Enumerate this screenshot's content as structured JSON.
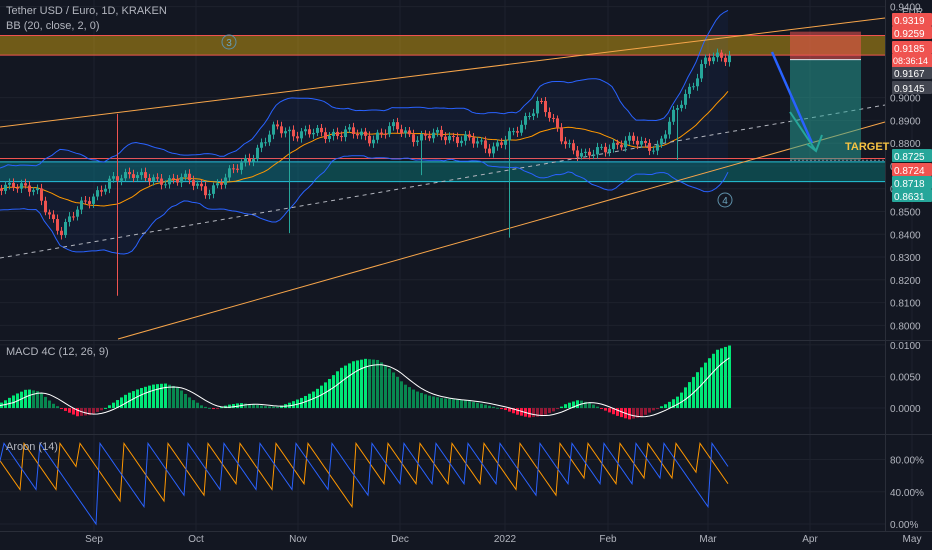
{
  "header": {
    "title": "Tether USD / Euro, 1D, KRAKEN",
    "indicator": "BB (20, close, 2, 0)",
    "currency": "EUR"
  },
  "macd_label": "MACD 4C (12, 26, 9)",
  "aroon_label": "Aroon (14)",
  "annotations": {
    "wave3": "3",
    "wave4": "4",
    "target": "TARGET",
    "countdown": "08:36:14"
  },
  "colors": {
    "background": "#131722",
    "bull": "#26a69a",
    "bear": "#ef5350",
    "bb_band": "#2962ff",
    "bb_basis": "#ff9800",
    "trendline": "#f7a54a",
    "zone_fill": "#f0b90b",
    "zone_support": "#0b6e6e",
    "macd_pos": "#00e676",
    "macd_neg": "#ff1744",
    "aroon_up": "#ff9800",
    "aroon_down": "#2962ff"
  },
  "chart_data": [
    {
      "type": "candlestick",
      "title": "Tether USD / Euro, 1D, KRAKEN",
      "ylim": [
        0.794,
        0.9407
      ],
      "x_ticks": [
        "Sep",
        "Oct",
        "Nov",
        "Dec",
        "2022",
        "Feb",
        "Mar",
        "Apr",
        "May"
      ],
      "y_ticks": [
        0.8,
        0.81,
        0.82,
        0.83,
        0.84,
        0.85,
        0.86,
        0.87,
        0.88,
        0.89,
        0.9,
        0.94
      ],
      "price_labels": [
        {
          "value": "0.9319",
          "color": "#ef5350"
        },
        {
          "value": "0.9259",
          "color": "#ef5350"
        },
        {
          "value": "0.9185",
          "color": "#ef5350"
        },
        {
          "value": "0.9167",
          "color": "#434651"
        },
        {
          "value": "0.9145",
          "color": "#434651"
        },
        {
          "value": "0.8725",
          "color": "#26a69a"
        },
        {
          "value": "0.8724",
          "color": "#ef5350"
        },
        {
          "value": "0.8718",
          "color": "#26a69a"
        },
        {
          "value": "0.8631",
          "color": "#26a69a"
        }
      ],
      "last_price": "0.9185",
      "zones": [
        {
          "name": "resistance",
          "from": 0.9187,
          "to": 0.9273
        },
        {
          "name": "support",
          "from": 0.8631,
          "to": 0.8718
        }
      ],
      "position": {
        "entry": 0.9167,
        "stop": 0.929,
        "target": 0.8725
      },
      "price_anchors": [
        0.8578,
        0.863,
        0.8576,
        0.841,
        0.8548,
        0.862,
        0.8679,
        0.8621,
        0.8658,
        0.8585,
        0.8656,
        0.8749,
        0.8865,
        0.8843,
        0.8842,
        0.8846,
        0.8826,
        0.8868,
        0.8822,
        0.8837,
        0.8814,
        0.8781,
        0.8838,
        0.8992,
        0.8818,
        0.8736,
        0.8794,
        0.8806,
        0.8784,
        0.8988,
        0.9162,
        0.9185
      ]
    },
    {
      "type": "bar",
      "title": "MACD 4C (12, 26, 9)",
      "ylim": [
        -0.003,
        0.0103
      ],
      "y_ticks": [
        "0.0100",
        "0.0050",
        "0.0000"
      ],
      "series": [
        {
          "name": "MACD",
          "values": [
            0.0001,
            0.0009,
            0.0021,
            0.003,
            0.0026,
            0.0008,
            -0.0004,
            -0.0013,
            -0.0011,
            -0.0003,
            0.001,
            0.0023,
            0.0031,
            0.0037,
            0.0039,
            0.0033,
            0.0016,
            0.0003,
            -0.0002,
            0.0005,
            0.0008,
            0.0006,
            0.0003,
            0.0002,
            0.0009,
            0.0017,
            0.0028,
            0.0044,
            0.0063,
            0.0074,
            0.0078,
            0.0076,
            0.0061,
            0.0039,
            0.0027,
            0.002,
            0.0016,
            0.0014,
            0.0012,
            0.0008,
            0.0003,
            -0.0002,
            -0.001,
            -0.0015,
            -0.0013,
            -0.0005,
            0.0007,
            0.0013,
            0.0007,
            -0.0003,
            -0.0012,
            -0.0018,
            -0.0014,
            -0.0003,
            0.0007,
            0.002,
            0.0046,
            0.007,
            0.0092,
            0.0099
          ]
        }
      ]
    },
    {
      "type": "line",
      "title": "Aroon (14)",
      "ylim": [
        -5,
        108
      ],
      "y_ticks": [
        "80.00%",
        "40.00%",
        "0.00%"
      ]
    }
  ]
}
